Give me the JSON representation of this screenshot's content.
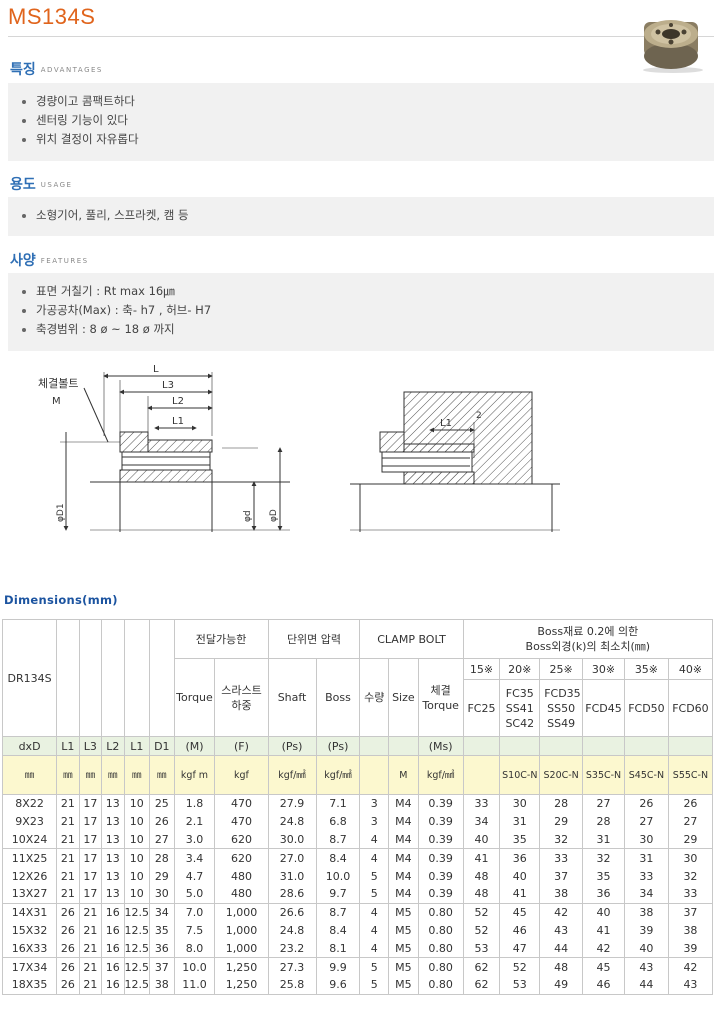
{
  "page": {
    "title": "MS134S"
  },
  "sections": {
    "advantages": {
      "title": "특징",
      "subtitle": "ADVANTAGES",
      "items": [
        "경량이고 콤팩트하다",
        "센터링 기능이 있다",
        "위치 결정이 자유롭다"
      ]
    },
    "usage": {
      "title": "용도",
      "subtitle": "USAGE",
      "items": [
        "소형기어, 풀리, 스프라켓, 캠 등"
      ]
    },
    "features": {
      "title": "사양",
      "subtitle": "FEATURES",
      "items": [
        "표면 거칠기 : Rt max 16㎛",
        "가공공차(Max) : 축- h7 ,   허브- H7",
        "축경범위 : 8 ø ~ 18 ø 까지"
      ]
    }
  },
  "diagram": {
    "bolt_label": "체결볼트",
    "bolt_label_m": "M",
    "l": "L",
    "l3": "L3",
    "l2": "L2",
    "l1": "L1",
    "d1": "φD1",
    "d": "φd",
    "D": "φD",
    "right_l1": "L1",
    "right_2": "2"
  },
  "dimensions": {
    "title": "Dimensions(mm)",
    "header": {
      "model": "DR134S",
      "transmit": "전달가능한",
      "unit_pressure": "단위면 압력",
      "clamp_bolt": "CLAMP BOLT",
      "boss_title_1": "Boss재료 0.2에 의한",
      "boss_title_2": "Boss외경(k)의 최소치(㎜)",
      "pct": [
        "15※",
        "20※",
        "25※",
        "30※",
        "35※",
        "40※"
      ],
      "torque": "Torque",
      "thrust": "스라스트 하중",
      "shaft": "Shaft",
      "boss": "Boss",
      "qty": "수량",
      "size": "Size",
      "clamp_torque": "체결 Torque",
      "materials": [
        "FC25",
        "FC35 SS41 SC42",
        "FCD35 SS50 SS49",
        "FCD45",
        "FCD50",
        "FCD60"
      ]
    },
    "symbols": [
      "dxD",
      "L1",
      "L3",
      "L2",
      "L1",
      "D1",
      "(M)",
      "(F)",
      "(Ps)",
      "(Ps)",
      "",
      "",
      "(Ms)",
      "",
      "",
      "",
      "",
      "",
      ""
    ],
    "units": [
      "㎜",
      "㎜",
      "㎜",
      "㎜",
      "㎜",
      "㎜",
      "kgf m",
      "kgf",
      "kgf/㎟",
      "kgf/㎟",
      "",
      "M",
      "kgf/㎟",
      "",
      "S10C-N",
      "S20C-N",
      "S35C-N",
      "S45C-N",
      "S55C-N"
    ],
    "rows": [
      [
        "8X22",
        "21",
        "17",
        "13",
        "10",
        "25",
        "1.8",
        "470",
        "27.9",
        "7.1",
        "3",
        "M4",
        "0.39",
        "33",
        "30",
        "28",
        "27",
        "26",
        "26"
      ],
      [
        "9X23",
        "21",
        "17",
        "13",
        "10",
        "26",
        "2.1",
        "470",
        "24.8",
        "6.8",
        "3",
        "M4",
        "0.39",
        "34",
        "31",
        "29",
        "28",
        "27",
        "27"
      ],
      [
        "10X24",
        "21",
        "17",
        "13",
        "10",
        "27",
        "3.0",
        "620",
        "30.0",
        "8.7",
        "4",
        "M4",
        "0.39",
        "40",
        "35",
        "32",
        "31",
        "30",
        "29"
      ],
      [
        "11X25",
        "21",
        "17",
        "13",
        "10",
        "28",
        "3.4",
        "620",
        "27.0",
        "8.4",
        "4",
        "M4",
        "0.39",
        "41",
        "36",
        "33",
        "32",
        "31",
        "30"
      ],
      [
        "12X26",
        "21",
        "17",
        "13",
        "10",
        "29",
        "4.7",
        "480",
        "31.0",
        "10.0",
        "5",
        "M4",
        "0.39",
        "48",
        "40",
        "37",
        "35",
        "33",
        "32"
      ],
      [
        "13X27",
        "21",
        "17",
        "13",
        "10",
        "30",
        "5.0",
        "480",
        "28.6",
        "9.7",
        "5",
        "M4",
        "0.39",
        "48",
        "41",
        "38",
        "36",
        "34",
        "33"
      ],
      [
        "14X31",
        "26",
        "21",
        "16",
        "12.5",
        "34",
        "7.0",
        "1,000",
        "26.6",
        "8.7",
        "4",
        "M5",
        "0.80",
        "52",
        "45",
        "42",
        "40",
        "38",
        "37"
      ],
      [
        "15X32",
        "26",
        "21",
        "16",
        "12.5",
        "35",
        "7.5",
        "1,000",
        "24.8",
        "8.4",
        "4",
        "M5",
        "0.80",
        "52",
        "46",
        "43",
        "41",
        "39",
        "38"
      ],
      [
        "16X33",
        "26",
        "21",
        "16",
        "12.5",
        "36",
        "8.0",
        "1,000",
        "23.2",
        "8.1",
        "4",
        "M5",
        "0.80",
        "53",
        "47",
        "44",
        "42",
        "40",
        "39"
      ],
      [
        "17X34",
        "26",
        "21",
        "16",
        "12.5",
        "37",
        "10.0",
        "1,250",
        "27.3",
        "9.9",
        "5",
        "M5",
        "0.80",
        "62",
        "52",
        "48",
        "45",
        "43",
        "42"
      ],
      [
        "18X35",
        "26",
        "21",
        "16",
        "12.5",
        "38",
        "11.0",
        "1,250",
        "25.8",
        "9.6",
        "5",
        "M5",
        "0.80",
        "62",
        "53",
        "49",
        "46",
        "44",
        "43"
      ]
    ]
  }
}
